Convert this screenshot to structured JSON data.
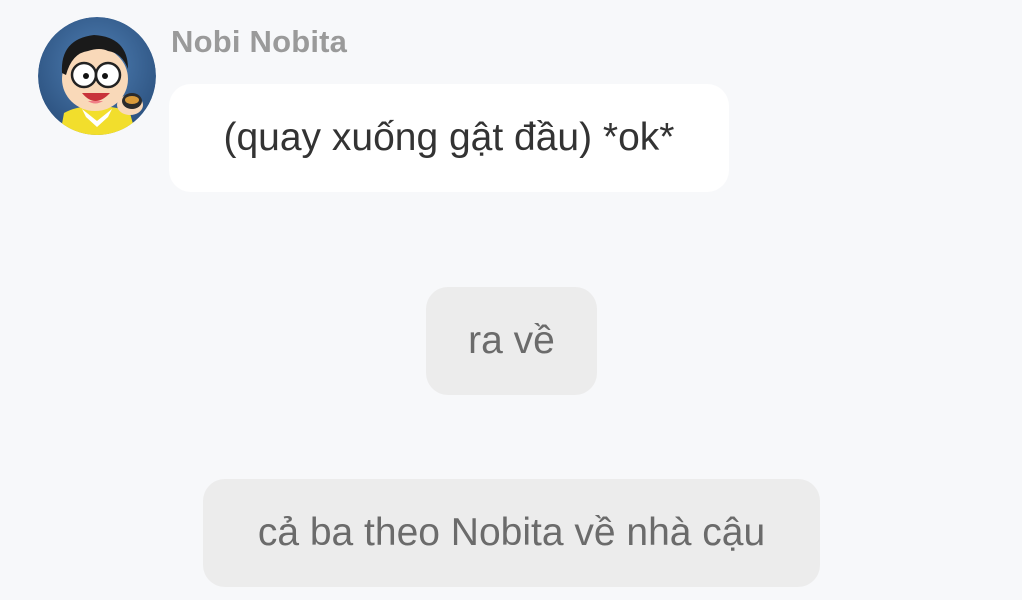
{
  "message": {
    "sender_name": "Nobi Nobita",
    "avatar_icon": "nobita-avatar-icon",
    "text": "(quay xuống gật đầu) *ok*"
  },
  "narration": [
    {
      "text": "ra về"
    },
    {
      "text": "cả ba theo Nobita về nhà cậu"
    }
  ],
  "colors": {
    "background": "#f7f8fa",
    "received_bubble": "#ffffff",
    "narration_bubble": "#ececec",
    "sender_name": "#9a9a9a"
  }
}
